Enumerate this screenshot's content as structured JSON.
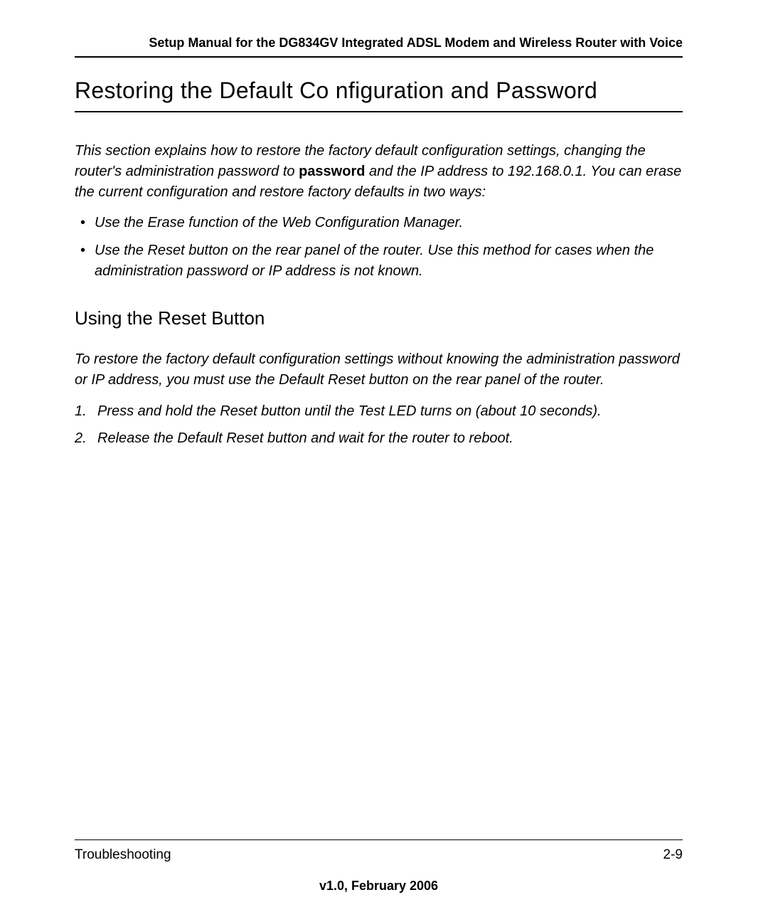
{
  "header": {
    "title": "Setup Manual for the DG834GV Integrated ADSL Modem and Wireless Router with Voice"
  },
  "mainHeading": "Restoring the Default Co   nfiguration and Password",
  "intro": {
    "part1": "This section explains how to restore the factory default configuration settings, changing the router's administration password to ",
    "boldWord": "password",
    "part2": " and the IP address to 192.168.0.1. You can erase the current configuration and restore factory defaults in two ways:"
  },
  "bullets": [
    "Use the Erase function of the Web Configuration Manager.",
    "Use the Reset button on the rear panel of the router. Use this method for cases when the administration password or IP address is not known."
  ],
  "subHeading": "Using the Reset Button",
  "resetIntro": "To restore the factory default configuration settings without knowing the administration password or IP address, you must use the Default Reset button on the rear panel of the router.",
  "steps": [
    "Press and hold the Reset button until the Test LED turns on (about 10 seconds).",
    "Release the Default Reset button and wait for the router to reboot."
  ],
  "footer": {
    "left": "Troubleshooting",
    "right": "2-9",
    "version": "v1.0, February 2006"
  }
}
